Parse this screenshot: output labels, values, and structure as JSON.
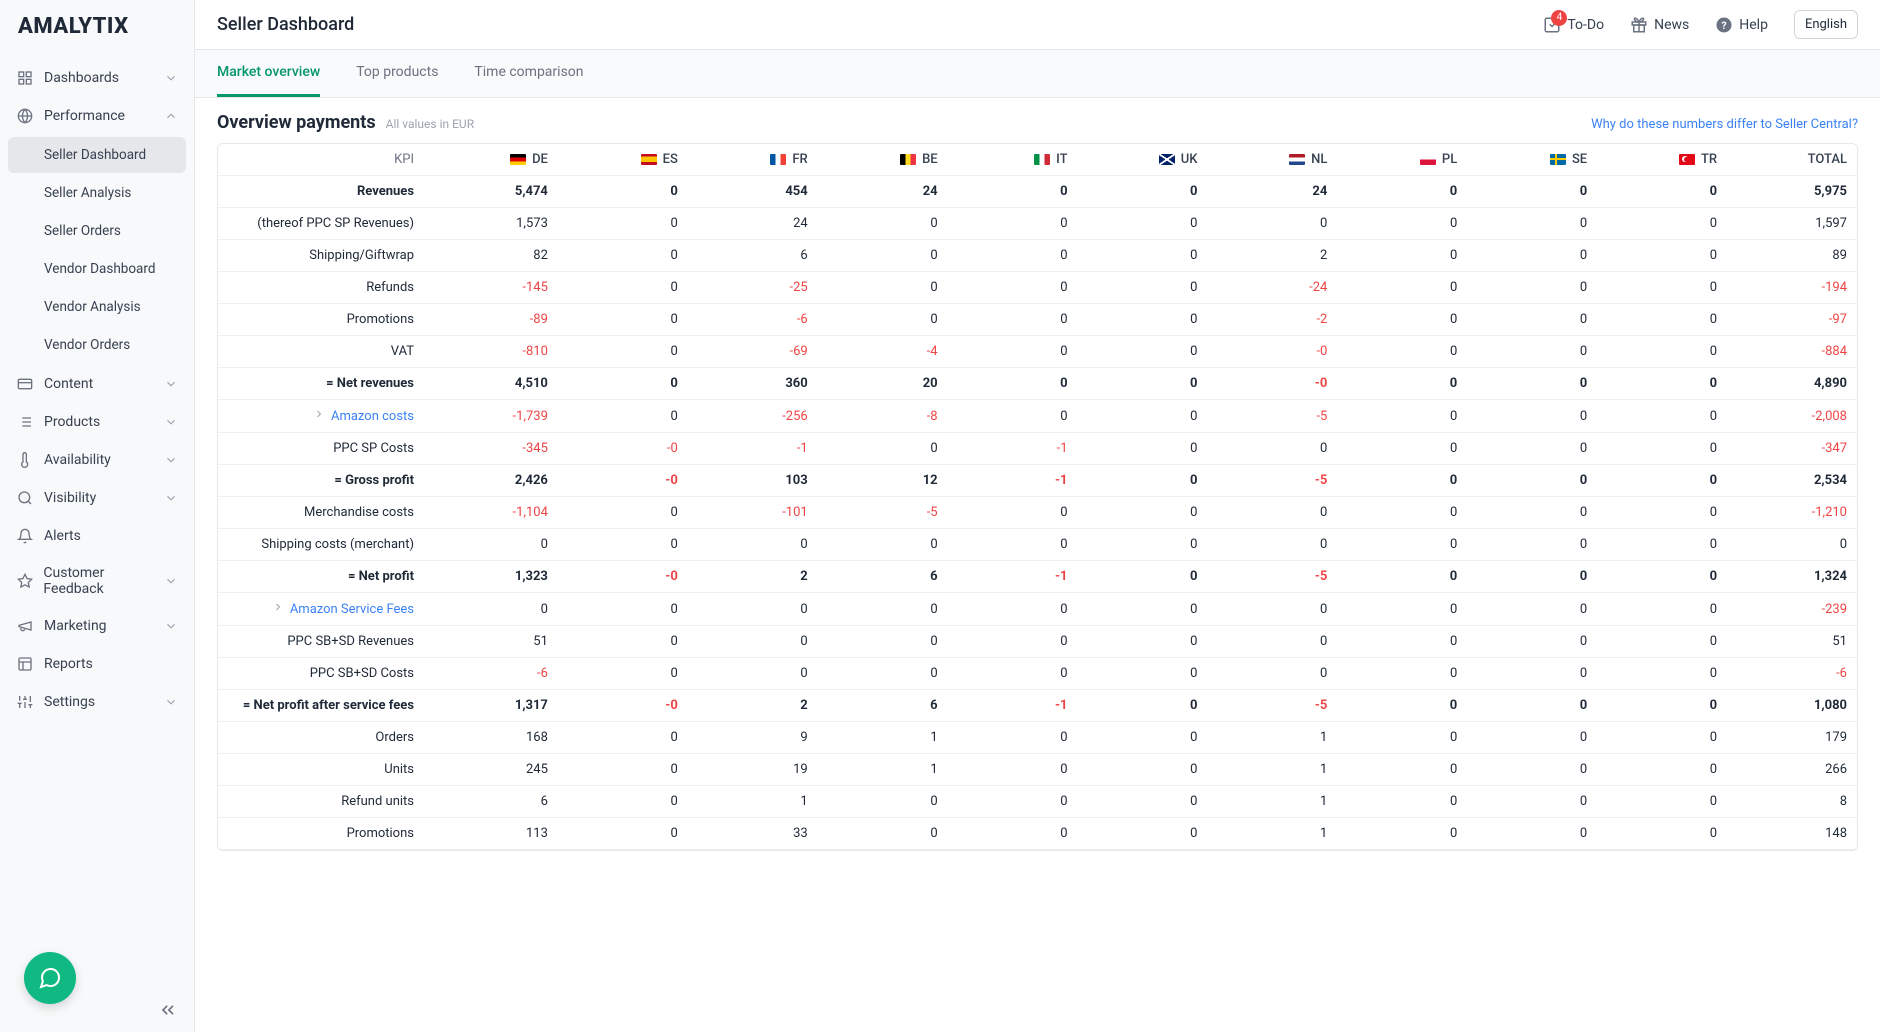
{
  "brand": "AMALYTIX",
  "header": {
    "title": "Seller Dashboard",
    "todo": {
      "label": "To-Do",
      "badge": "4"
    },
    "news": "News",
    "help": "Help",
    "language": "English"
  },
  "sidebar": {
    "items": [
      {
        "label": "Dashboards",
        "icon": "dashboard-icon",
        "expandable": true,
        "expanded": false
      },
      {
        "label": "Performance",
        "icon": "globe-icon",
        "expandable": true,
        "expanded": true,
        "children": [
          {
            "label": "Seller Dashboard",
            "active": true
          },
          {
            "label": "Seller Analysis"
          },
          {
            "label": "Seller Orders"
          },
          {
            "label": "Vendor Dashboard"
          },
          {
            "label": "Vendor Analysis"
          },
          {
            "label": "Vendor Orders"
          }
        ]
      },
      {
        "label": "Content",
        "icon": "card-icon",
        "expandable": true
      },
      {
        "label": "Products",
        "icon": "list-icon",
        "expandable": true
      },
      {
        "label": "Availability",
        "icon": "thermometer-icon",
        "expandable": true
      },
      {
        "label": "Visibility",
        "icon": "search-icon",
        "expandable": true
      },
      {
        "label": "Alerts",
        "icon": "bell-icon"
      },
      {
        "label": "Customer Feedback",
        "icon": "star-icon",
        "expandable": true
      },
      {
        "label": "Marketing",
        "icon": "megaphone-icon",
        "expandable": true
      },
      {
        "label": "Reports",
        "icon": "table-icon"
      },
      {
        "label": "Settings",
        "icon": "sliders-icon",
        "expandable": true
      }
    ]
  },
  "tabs": [
    {
      "label": "Market overview",
      "active": true
    },
    {
      "label": "Top products"
    },
    {
      "label": "Time comparison"
    }
  ],
  "section": {
    "title": "Overview payments",
    "subtitle": "All values in EUR",
    "infoLink": "Why do these numbers differ to Seller Central?"
  },
  "columns": [
    {
      "key": "kpi",
      "label": "KPI"
    },
    {
      "key": "de",
      "label": "DE",
      "flag": "flag-de"
    },
    {
      "key": "es",
      "label": "ES",
      "flag": "flag-es"
    },
    {
      "key": "fr",
      "label": "FR",
      "flag": "flag-fr"
    },
    {
      "key": "be",
      "label": "BE",
      "flag": "flag-be"
    },
    {
      "key": "it",
      "label": "IT",
      "flag": "flag-it"
    },
    {
      "key": "uk",
      "label": "UK",
      "flag": "flag-uk"
    },
    {
      "key": "nl",
      "label": "NL",
      "flag": "flag-nl"
    },
    {
      "key": "pl",
      "label": "PL",
      "flag": "flag-pl"
    },
    {
      "key": "se",
      "label": "SE",
      "flag": "flag-se"
    },
    {
      "key": "tr",
      "label": "TR",
      "flag": "flag-tr"
    },
    {
      "key": "total",
      "label": "TOTAL"
    }
  ],
  "rows": [
    {
      "kpi": "Revenues",
      "bold": true,
      "v": [
        "5,474",
        "0",
        "454",
        "24",
        "0",
        "0",
        "24",
        "0",
        "0",
        "0",
        "5,975"
      ]
    },
    {
      "kpi": "(thereof PPC SP Revenues)",
      "v": [
        "1,573",
        "0",
        "24",
        "0",
        "0",
        "0",
        "0",
        "0",
        "0",
        "0",
        "1,597"
      ]
    },
    {
      "kpi": "Shipping/Giftwrap",
      "v": [
        "82",
        "0",
        "6",
        "0",
        "0",
        "0",
        "2",
        "0",
        "0",
        "0",
        "89"
      ]
    },
    {
      "kpi": "Refunds",
      "neg": [
        0,
        2,
        6,
        10
      ],
      "v": [
        "-145",
        "0",
        "-25",
        "0",
        "0",
        "0",
        "-24",
        "0",
        "0",
        "0",
        "-194"
      ]
    },
    {
      "kpi": "Promotions",
      "neg": [
        0,
        2,
        6,
        10
      ],
      "v": [
        "-89",
        "0",
        "-6",
        "0",
        "0",
        "0",
        "-2",
        "0",
        "0",
        "0",
        "-97"
      ]
    },
    {
      "kpi": "VAT",
      "neg": [
        0,
        2,
        3,
        6,
        10
      ],
      "v": [
        "-810",
        "0",
        "-69",
        "-4",
        "0",
        "0",
        "-0",
        "0",
        "0",
        "0",
        "-884"
      ]
    },
    {
      "kpi": "= Net revenues",
      "bold": true,
      "neg": [
        6
      ],
      "v": [
        "4,510",
        "0",
        "360",
        "20",
        "0",
        "0",
        "-0",
        "0",
        "0",
        "0",
        "4,890"
      ]
    },
    {
      "kpi": "Amazon costs",
      "link": true,
      "expand": true,
      "neg": [
        0,
        2,
        3,
        6,
        10
      ],
      "v": [
        "-1,739",
        "0",
        "-256",
        "-8",
        "0",
        "0",
        "-5",
        "0",
        "0",
        "0",
        "-2,008"
      ]
    },
    {
      "kpi": "PPC SP Costs",
      "neg": [
        0,
        1,
        2,
        4,
        10
      ],
      "v": [
        "-345",
        "-0",
        "-1",
        "0",
        "-1",
        "0",
        "0",
        "0",
        "0",
        "0",
        "-347"
      ]
    },
    {
      "kpi": "= Gross profit",
      "bold": true,
      "neg": [
        1,
        4,
        6
      ],
      "v": [
        "2,426",
        "-0",
        "103",
        "12",
        "-1",
        "0",
        "-5",
        "0",
        "0",
        "0",
        "2,534"
      ]
    },
    {
      "kpi": "Merchandise costs",
      "neg": [
        0,
        2,
        3,
        10
      ],
      "v": [
        "-1,104",
        "0",
        "-101",
        "-5",
        "0",
        "0",
        "0",
        "0",
        "0",
        "0",
        "-1,210"
      ]
    },
    {
      "kpi": "Shipping costs (merchant)",
      "v": [
        "0",
        "0",
        "0",
        "0",
        "0",
        "0",
        "0",
        "0",
        "0",
        "0",
        "0"
      ]
    },
    {
      "kpi": "= Net profit",
      "bold": true,
      "neg": [
        1,
        4,
        6
      ],
      "v": [
        "1,323",
        "-0",
        "2",
        "6",
        "-1",
        "0",
        "-5",
        "0",
        "0",
        "0",
        "1,324"
      ]
    },
    {
      "kpi": "Amazon Service Fees",
      "link": true,
      "expand": true,
      "neg": [
        10
      ],
      "v": [
        "0",
        "0",
        "0",
        "0",
        "0",
        "0",
        "0",
        "0",
        "0",
        "0",
        "-239"
      ]
    },
    {
      "kpi": "PPC SB+SD Revenues",
      "v": [
        "51",
        "0",
        "0",
        "0",
        "0",
        "0",
        "0",
        "0",
        "0",
        "0",
        "51"
      ]
    },
    {
      "kpi": "PPC SB+SD Costs",
      "neg": [
        0,
        10
      ],
      "v": [
        "-6",
        "0",
        "0",
        "0",
        "0",
        "0",
        "0",
        "0",
        "0",
        "0",
        "-6"
      ]
    },
    {
      "kpi": "= Net profit after service fees",
      "bold": true,
      "neg": [
        1,
        4,
        6
      ],
      "v": [
        "1,317",
        "-0",
        "2",
        "6",
        "-1",
        "0",
        "-5",
        "0",
        "0",
        "0",
        "1,080"
      ]
    },
    {
      "kpi": "Orders",
      "v": [
        "168",
        "0",
        "9",
        "1",
        "0",
        "0",
        "1",
        "0",
        "0",
        "0",
        "179"
      ]
    },
    {
      "kpi": "Units",
      "v": [
        "245",
        "0",
        "19",
        "1",
        "0",
        "0",
        "1",
        "0",
        "0",
        "0",
        "266"
      ]
    },
    {
      "kpi": "Refund units",
      "v": [
        "6",
        "0",
        "1",
        "0",
        "0",
        "0",
        "1",
        "0",
        "0",
        "0",
        "8"
      ]
    },
    {
      "kpi": "Promotions",
      "v": [
        "113",
        "0",
        "33",
        "0",
        "0",
        "0",
        "1",
        "0",
        "0",
        "0",
        "148"
      ]
    }
  ]
}
